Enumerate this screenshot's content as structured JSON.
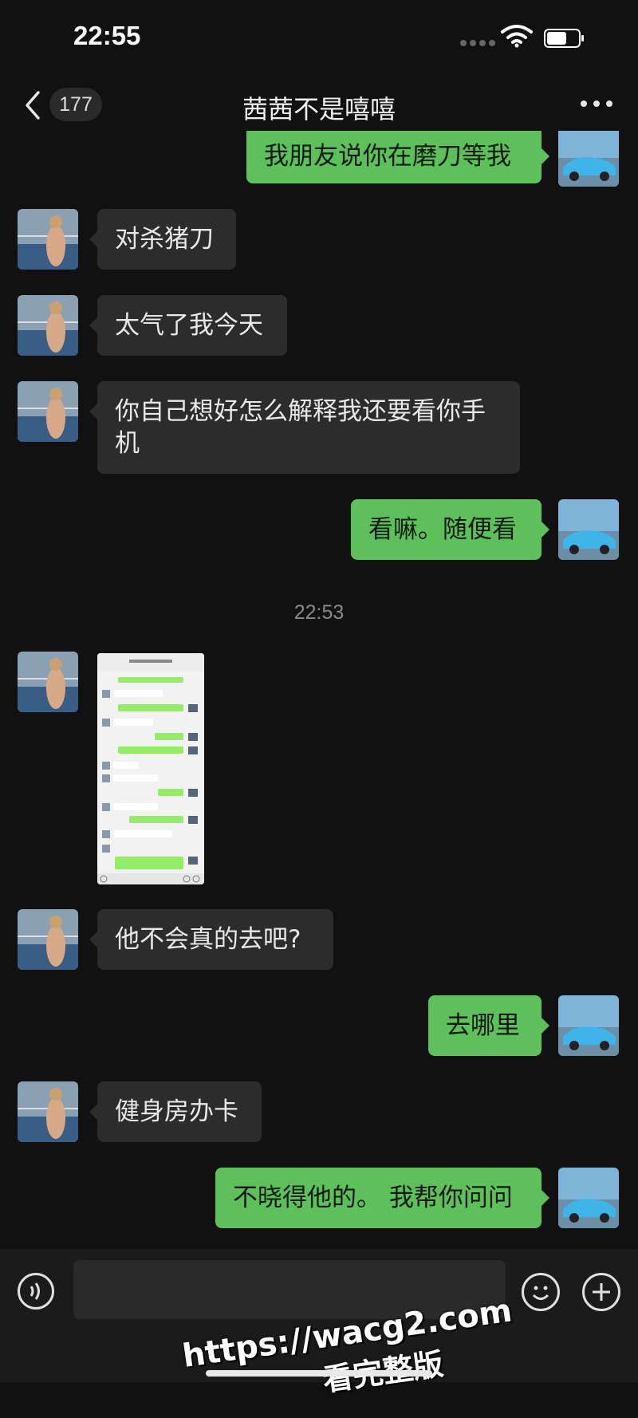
{
  "status_bar": {
    "time": "22:55"
  },
  "nav": {
    "back_count": "177",
    "title": "茜茜不是嘻嘻"
  },
  "messages": [
    {
      "from": "me",
      "text": "我朋友说你在磨刀等我"
    },
    {
      "from": "them",
      "text": "对杀猪刀"
    },
    {
      "from": "them",
      "text": "太气了我今天"
    },
    {
      "from": "them",
      "text": "你自己想好怎么解释我还要看你手机"
    },
    {
      "from": "me",
      "text": "看嘛。随便看"
    },
    {
      "from": "them",
      "text": "他不会真的去吧?"
    },
    {
      "from": "me",
      "text": "去哪里"
    },
    {
      "from": "them",
      "text": "健身房办卡"
    },
    {
      "from": "me",
      "text": "不晓得他的。 我帮你问问"
    }
  ],
  "timestamp": "22:53",
  "watermark": {
    "line1": "https://wacg2.com",
    "line2": "看完整版"
  },
  "colors": {
    "bg": "#111111",
    "incoming": "#2c2c2c",
    "outgoing": "#5ec05a"
  },
  "icons": [
    "back-chevron-icon",
    "more-dots-icon",
    "voice-icon",
    "emoji-icon",
    "plus-icon",
    "wifi-icon",
    "battery-icon"
  ]
}
